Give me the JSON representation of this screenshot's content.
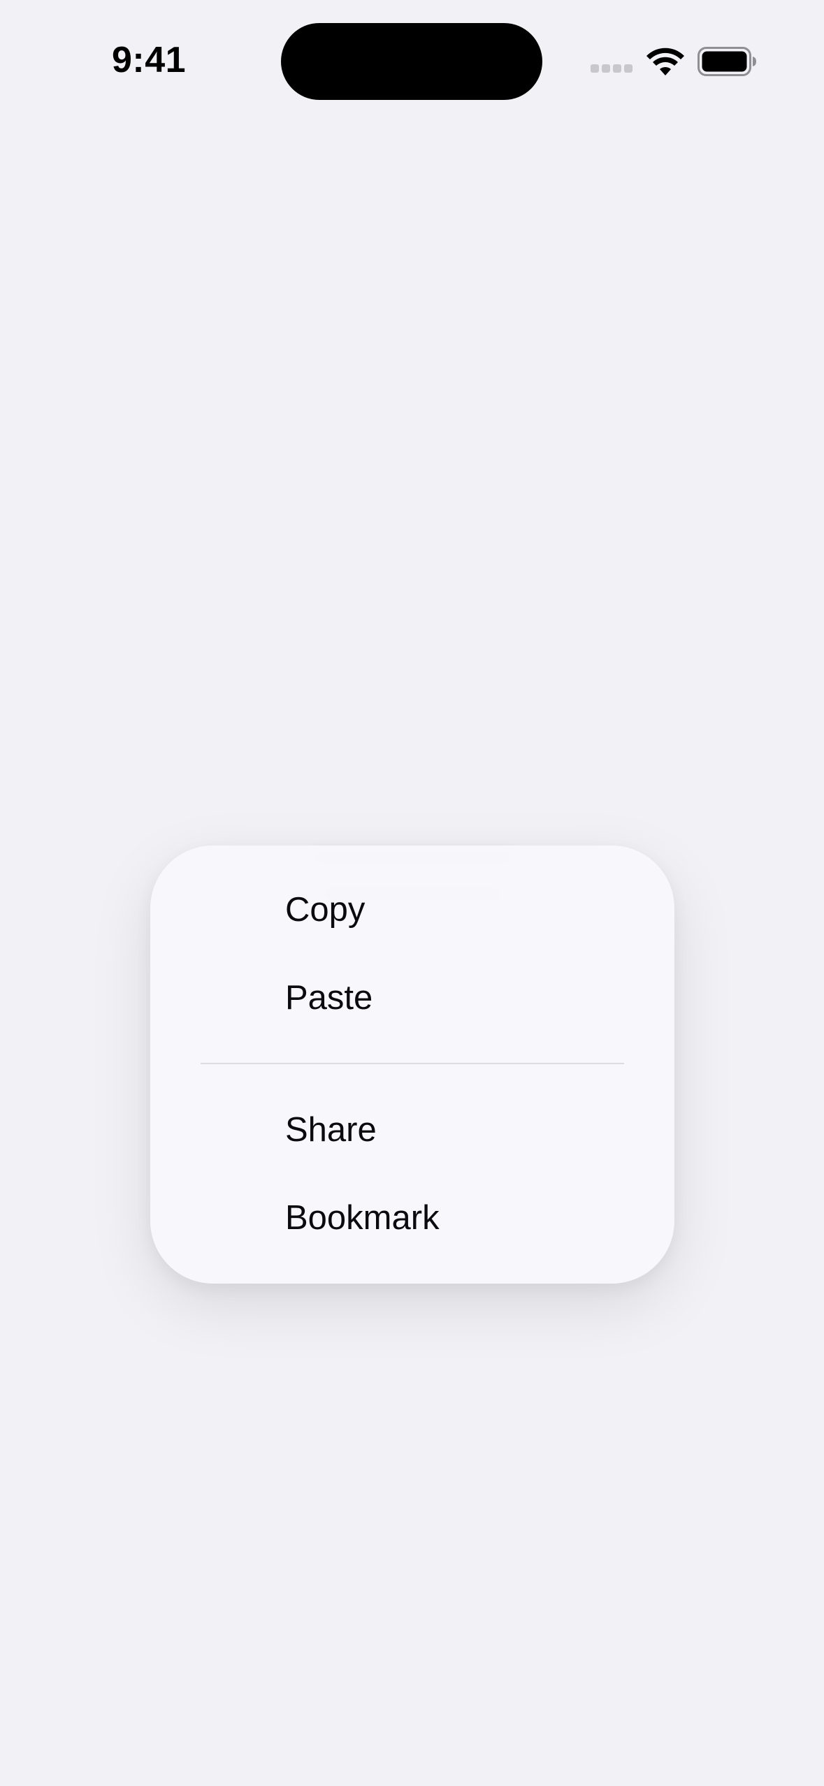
{
  "status_bar": {
    "time": "9:41"
  },
  "menu": {
    "items": [
      {
        "label": "Copy"
      },
      {
        "label": "Paste"
      },
      {
        "label": "Share"
      },
      {
        "label": "Bookmark"
      }
    ]
  },
  "colors": {
    "background": "#f1f1f6",
    "menu_surface": "#f8f8fc",
    "text": "#0b0b0f",
    "divider": "#dcdce2"
  }
}
